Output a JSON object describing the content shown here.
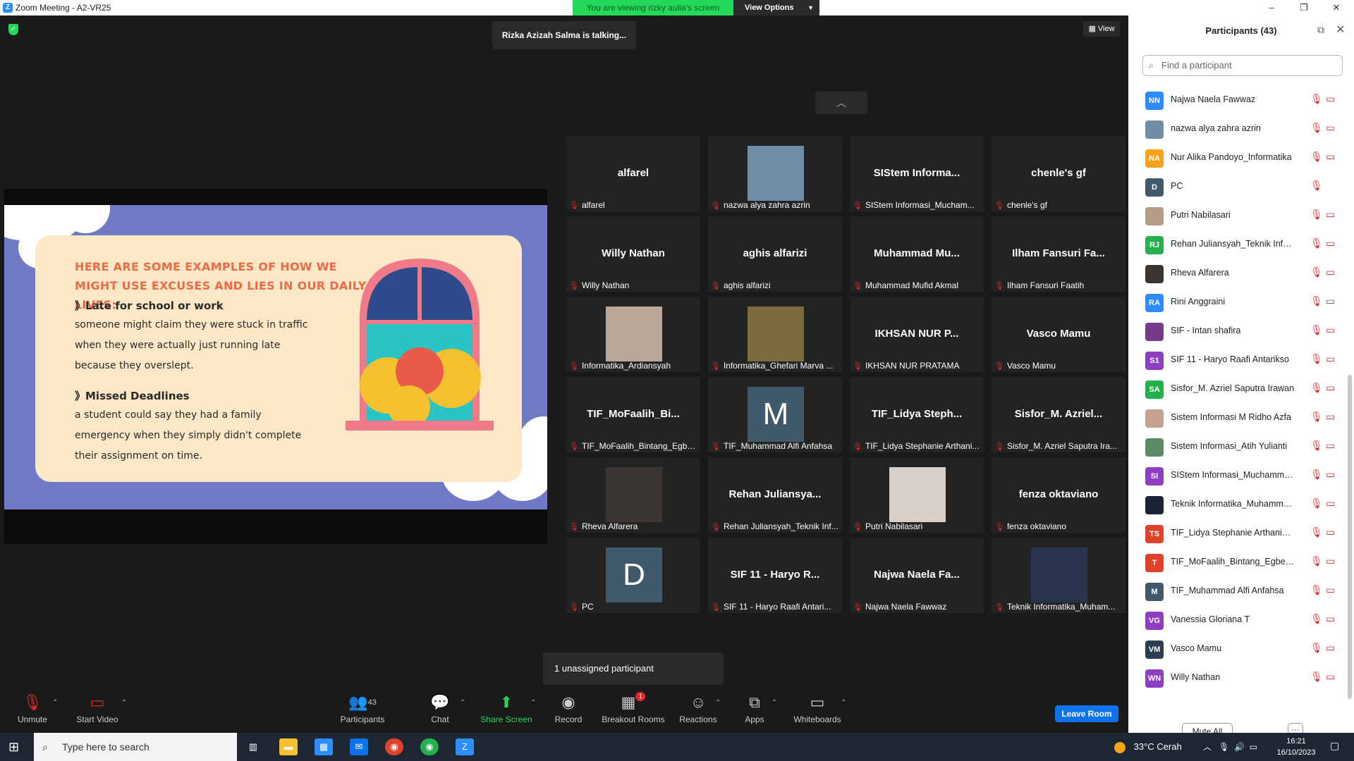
{
  "window": {
    "title": "Zoom Meeting - A2-VR25",
    "viewing_banner": "You are viewing rizky aulia's screen",
    "view_options": "View Options"
  },
  "meeting": {
    "talking": "Rizka Azizah Salma is talking...",
    "view_label": "View",
    "unassigned": "1 unassigned participant"
  },
  "slide": {
    "heading": "HERE ARE SOME EXAMPLES OF HOW WE MIGHT USE EXCUSES AND LIES IN OUR DAILY LIVES:",
    "point1_title": "》Late for school or work",
    "point1_body": "someone might claim they were stuck in traffic when they were actually just running late because they overslept.",
    "point2_title": "》Missed Deadlines",
    "point2_body": "a student could say they had a family emergency when they simply didn't complete their assignment on time."
  },
  "tiles": [
    {
      "name": "alfarel",
      "label": "alfarel",
      "kind": "name"
    },
    {
      "name": "",
      "label": "nazwa alya zahra azrin",
      "kind": "photo",
      "color": "#6f8fa8"
    },
    {
      "name": "SIStem Informa...",
      "label": "SIStem Informasi_Mucham...",
      "kind": "name"
    },
    {
      "name": "chenle's gf",
      "label": "chenle's gf",
      "kind": "name"
    },
    {
      "name": "Willy Nathan",
      "label": "Willy Nathan",
      "kind": "name"
    },
    {
      "name": "aghis alfarizi",
      "label": "aghis alfarizi",
      "kind": "name"
    },
    {
      "name": "Muhammad Mu...",
      "label": "Muhammad Mufid Akmal",
      "kind": "name"
    },
    {
      "name": "Ilham Fansuri Fa...",
      "label": "Ilham Fansuri Faatih",
      "kind": "name"
    },
    {
      "name": "",
      "label": "Informatika_Ardiansyah",
      "kind": "photo",
      "color": "#b9a89a"
    },
    {
      "name": "",
      "label": "Informatika_Ghefari Marva ...",
      "kind": "photo",
      "color": "#7d6a3f"
    },
    {
      "name": "IKHSAN NUR P...",
      "label": "IKHSAN NUR PRATAMA",
      "kind": "name"
    },
    {
      "name": "Vasco Mamu",
      "label": "Vasco Mamu",
      "kind": "name"
    },
    {
      "name": "TIF_MoFaalih_Bi...",
      "label": "TIF_MoFaalih_Bintang_Egbe...",
      "kind": "name"
    },
    {
      "name": "M",
      "label": "TIF_Muhammad Alfi Anfahsa",
      "kind": "letter"
    },
    {
      "name": "TIF_Lidya Steph...",
      "label": "TIF_Lidya Stephanie Arthani...",
      "kind": "name"
    },
    {
      "name": "Sisfor_M. Azriel...",
      "label": "Sisfor_M. Azriel Saputra Ira...",
      "kind": "name"
    },
    {
      "name": "",
      "label": "Rheva Alfarera",
      "kind": "photo",
      "color": "#3a3530"
    },
    {
      "name": "Rehan Juliansya...",
      "label": "Rehan Juliansyah_Teknik Inf...",
      "kind": "name"
    },
    {
      "name": "",
      "label": "Putri Nabilasari",
      "kind": "photo",
      "color": "#d9cfc6"
    },
    {
      "name": "fenza oktaviano",
      "label": "fenza oktaviano",
      "kind": "name"
    },
    {
      "name": "D",
      "label": "PC",
      "kind": "letter"
    },
    {
      "name": "SIF 11 - Haryo R...",
      "label": "SIF 11 - Haryo Raafi Antari...",
      "kind": "name"
    },
    {
      "name": "Najwa Naela Fa...",
      "label": "Najwa Naela Fawwaz",
      "kind": "name"
    },
    {
      "name": "",
      "label": "Teknik Informatika_Muham...",
      "kind": "photo",
      "color": "#2a3650"
    }
  ],
  "toolbar": {
    "unmute": "Unmute",
    "start_video": "Start Video",
    "participants": "Participants",
    "participants_count": "43",
    "chat": "Chat",
    "share_screen": "Share Screen",
    "record": "Record",
    "breakout_rooms": "Breakout Rooms",
    "breakout_badge": "1",
    "reactions": "Reactions",
    "apps": "Apps",
    "whiteboards": "Whiteboards",
    "leave_room": "Leave Room"
  },
  "panel": {
    "title": "Participants (43)",
    "search_placeholder": "Find a participant",
    "mute_all": "Mute All",
    "more": "···",
    "participants": [
      {
        "initials": "NN",
        "name": "Najwa Naela Fawwaz",
        "color": "#2d8cff",
        "video": false
      },
      {
        "initials": "",
        "name": "nazwa alya zahra azrin",
        "color": "#6f8fa8",
        "video": false
      },
      {
        "initials": "NA",
        "name": "Nur Alika Pandoyo_Informatika",
        "color": "#f7a21b",
        "video": false
      },
      {
        "initials": "D",
        "name": "PC",
        "color": "#415a6b",
        "video": null
      },
      {
        "initials": "",
        "name": "Putri Nabilasari",
        "color": "#b49b86",
        "video": false
      },
      {
        "initials": "RJ",
        "name": "Rehan Juliansyah_Teknik Inform...",
        "color": "#23b14d",
        "video": false
      },
      {
        "initials": "",
        "name": "Rheva Alfarera",
        "color": "#3a3530",
        "video": false
      },
      {
        "initials": "RA",
        "name": "Rini Anggraini",
        "color": "#2d8cff",
        "video": true
      },
      {
        "initials": "",
        "name": "SIF - Intan shafira",
        "color": "#7a3a8a",
        "video": false
      },
      {
        "initials": "S1",
        "name": "SIF 11 - Haryo Raafi Antarikso",
        "color": "#8e3ec2",
        "video": false
      },
      {
        "initials": "SA",
        "name": "Sisfor_M. Azriel Saputra Irawan",
        "color": "#23b14d",
        "video": false
      },
      {
        "initials": "",
        "name": "Sistem Informasi M Ridho Azfa",
        "color": "#c7a08f",
        "video": false
      },
      {
        "initials": "",
        "name": "Sistem Informasi_Atih Yulianti",
        "color": "#5b8a66",
        "video": false
      },
      {
        "initials": "SI",
        "name": "SIStem Informasi_Muchammad ...",
        "color": "#8e3ec2",
        "video": false
      },
      {
        "initials": "",
        "name": "Teknik Informatika_Muhammad...",
        "color": "#1c2433",
        "video": false
      },
      {
        "initials": "TS",
        "name": "TIF_Lidya Stephanie Arthania Sit...",
        "color": "#e0412b",
        "video": false
      },
      {
        "initials": "T",
        "name": "TIF_MoFaalih_Bintang_Egbert_L...",
        "color": "#e0412b",
        "video": false
      },
      {
        "initials": "M",
        "name": "TIF_Muhammad Alfi Anfahsa",
        "color": "#415a6b",
        "video": false
      },
      {
        "initials": "VG",
        "name": "Vanessia Gloriana T",
        "color": "#8e3ec2",
        "video": false
      },
      {
        "initials": "VM",
        "name": "Vasco Mamu",
        "color": "#2c3e50",
        "video": false
      },
      {
        "initials": "WN",
        "name": "Willy Nathan",
        "color": "#8e3ec2",
        "video": false
      }
    ]
  },
  "taskbar": {
    "search": "Type here to search",
    "weather": "33°C Cerah",
    "time": "16:21",
    "date": "16/10/2023"
  }
}
